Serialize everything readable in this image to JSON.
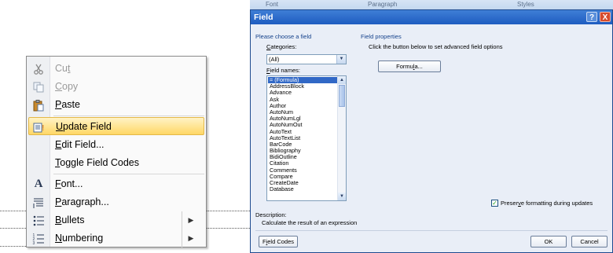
{
  "context_menu": {
    "items": [
      {
        "label_pre": "Cu",
        "label_u": "t",
        "label_post": "",
        "icon": "scissors-icon",
        "disabled": true,
        "highlight": false,
        "submenu": false
      },
      {
        "label_pre": "",
        "label_u": "C",
        "label_post": "opy",
        "icon": "copy-icon",
        "disabled": true,
        "highlight": false,
        "submenu": false
      },
      {
        "label_pre": "",
        "label_u": "P",
        "label_post": "aste",
        "icon": "paste-icon",
        "disabled": false,
        "highlight": false,
        "submenu": false
      },
      {
        "label_pre": "",
        "label_u": "U",
        "label_post": "pdate Field",
        "icon": "update-field-icon",
        "disabled": false,
        "highlight": true,
        "submenu": false
      },
      {
        "label_pre": "",
        "label_u": "E",
        "label_post": "dit Field...",
        "icon": "",
        "disabled": false,
        "highlight": false,
        "submenu": false
      },
      {
        "label_pre": "",
        "label_u": "T",
        "label_post": "oggle Field Codes",
        "icon": "",
        "disabled": false,
        "highlight": false,
        "submenu": false
      },
      {
        "label_pre": "",
        "label_u": "F",
        "label_post": "ont...",
        "icon": "font-icon",
        "disabled": false,
        "highlight": false,
        "submenu": false
      },
      {
        "label_pre": "",
        "label_u": "P",
        "label_post": "aragraph...",
        "icon": "paragraph-icon",
        "disabled": false,
        "highlight": false,
        "submenu": false
      },
      {
        "label_pre": "",
        "label_u": "B",
        "label_post": "ullets",
        "icon": "bullets-icon",
        "disabled": false,
        "highlight": false,
        "submenu": true
      },
      {
        "label_pre": "",
        "label_u": "N",
        "label_post": "umbering",
        "icon": "numbering-icon",
        "disabled": false,
        "highlight": false,
        "submenu": true
      }
    ],
    "submenu_arrow": "▶"
  },
  "ribbon": {
    "groups": [
      "Font",
      "Paragraph",
      "Styles"
    ]
  },
  "dialog": {
    "title": "Field",
    "help_glyph": "?",
    "close_glyph": "X",
    "choose_heading": "Please choose a field",
    "categories_label_u": "C",
    "categories_label_rest": "ategories:",
    "categories_value": "(All)",
    "field_names_label_u": "F",
    "field_names_label_rest": "ield names:",
    "field_names": [
      "= (Formula)",
      "AddressBlock",
      "Advance",
      "Ask",
      "Author",
      "AutoNum",
      "AutoNumLgl",
      "AutoNumOut",
      "AutoText",
      "AutoTextList",
      "BarCode",
      "Bibliography",
      "BidiOutline",
      "Citation",
      "Comments",
      "Compare",
      "CreateDate",
      "Database"
    ],
    "selected_index": 0,
    "properties_heading": "Field properties",
    "properties_hint": "Click the button below to set advanced field options",
    "formula_button_pre": "Formu",
    "formula_button_u": "l",
    "formula_button_post": "a...",
    "preserve_pre": "Preser",
    "preserve_u": "v",
    "preserve_post": "e formatting during updates",
    "preserve_checked": true,
    "description_label": "Description:",
    "description_text": "Calculate the result of an expression",
    "field_codes_button_pre": "F",
    "field_codes_button_u": "i",
    "field_codes_button_post": "eld Codes",
    "ok_label": "OK",
    "cancel_label": "Cancel"
  }
}
